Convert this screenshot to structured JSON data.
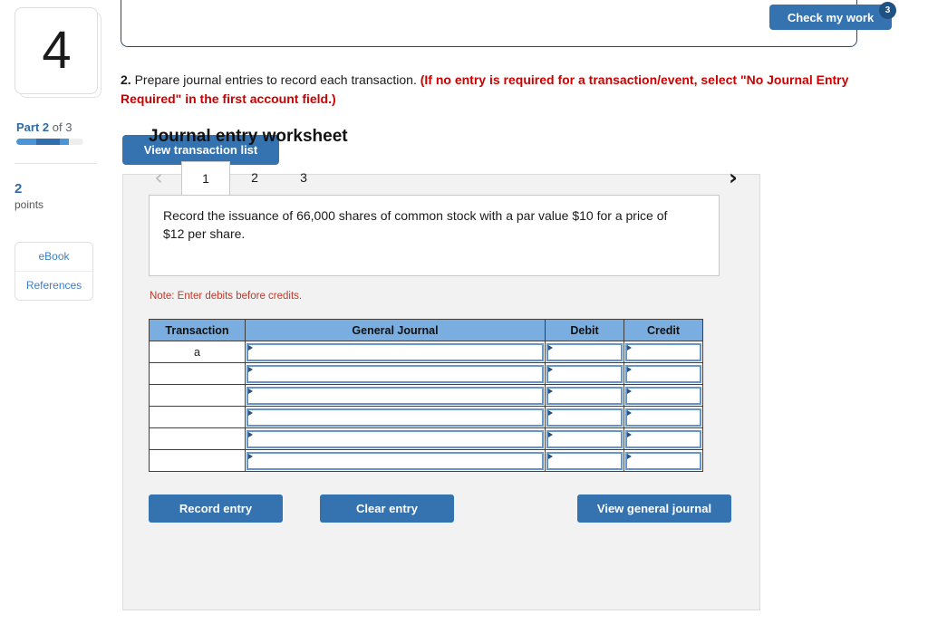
{
  "sidebar": {
    "question_number": "4",
    "part_label_prefix": "Part",
    "part_current": "2",
    "part_suffix": "of 3",
    "points_value": "2",
    "points_label": "points",
    "resources": [
      {
        "label": "eBook"
      },
      {
        "label": "References"
      }
    ]
  },
  "header": {
    "check_my_work_label": "Check my work",
    "check_my_work_badge": "3"
  },
  "question": {
    "number": "2.",
    "prompt": "Prepare journal entries to record each transaction.",
    "note_bold": "(If no entry is required for a transaction/event, select \"No Journal Entry Required\" in the first account field.)",
    "view_transaction_list_label": "View transaction list"
  },
  "worksheet": {
    "title": "Journal entry worksheet",
    "prev_icon": "chevron-left-icon",
    "next_icon": "chevron-right-icon",
    "prev_glyph": "‹",
    "next_glyph": "›",
    "tabs": [
      {
        "label": "1",
        "active": true
      },
      {
        "label": "2",
        "active": false
      },
      {
        "label": "3",
        "active": false
      }
    ],
    "transaction_text": "Record the issuance of 66,000 shares of common stock with a par value $10 for a price of $12 per share.",
    "note": "Note: Enter debits before credits.",
    "table": {
      "columns": [
        "Transaction",
        "General Journal",
        "Debit",
        "Credit"
      ],
      "rows": [
        {
          "transaction": "a",
          "general_journal": "",
          "debit": "",
          "credit": ""
        },
        {
          "transaction": "",
          "general_journal": "",
          "debit": "",
          "credit": ""
        },
        {
          "transaction": "",
          "general_journal": "",
          "debit": "",
          "credit": ""
        },
        {
          "transaction": "",
          "general_journal": "",
          "debit": "",
          "credit": ""
        },
        {
          "transaction": "",
          "general_journal": "",
          "debit": "",
          "credit": ""
        },
        {
          "transaction": "",
          "general_journal": "",
          "debit": "",
          "credit": ""
        }
      ]
    },
    "buttons": {
      "record_entry": "Record entry",
      "clear_entry": "Clear entry",
      "view_general_journal": "View general journal"
    }
  },
  "colors": {
    "button_blue": "#3572b0",
    "table_header_blue": "#7aaee0",
    "cell_border_blue": "#6596c9",
    "accent_link": "#3c7fc4",
    "alert_red": "#cc0000",
    "note_red": "#c0392b",
    "panel_gray": "#f2f2f2"
  }
}
